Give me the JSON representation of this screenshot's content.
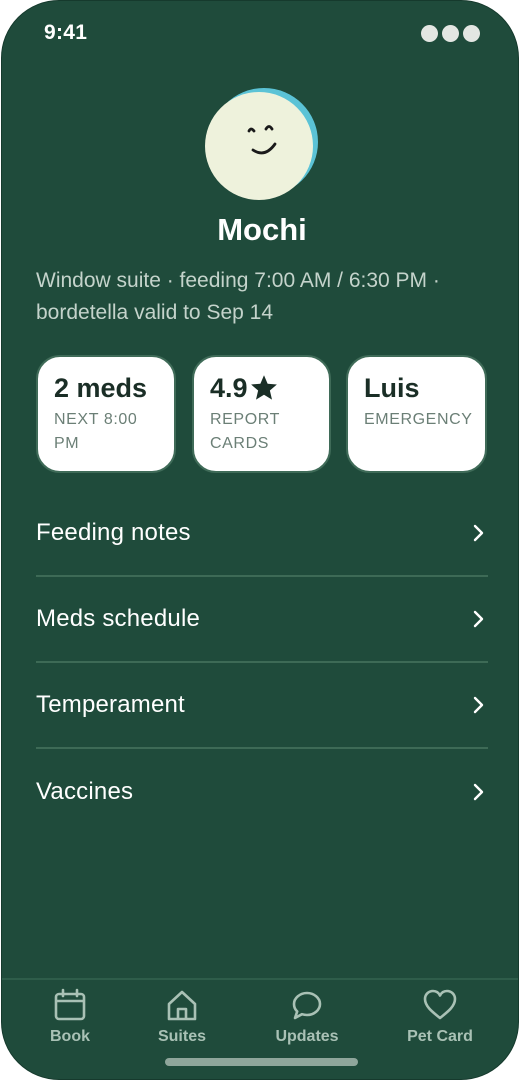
{
  "status_bar": {
    "time": "9:41"
  },
  "profile": {
    "name": "Mochi",
    "summary": "Window suite · feeding 7:00 AM / 6:30 PM · bordetella valid to Sep 14"
  },
  "stats": [
    {
      "value": "2 meds",
      "label": "NEXT 8:00 PM"
    },
    {
      "value": "4.9",
      "icon": "star-icon",
      "label": "REPORT CARDS"
    },
    {
      "value": "Luis",
      "label": "EMERGENCY"
    }
  ],
  "menu": [
    {
      "label": "Feeding notes",
      "icon": "chevron-right-icon"
    },
    {
      "label": "Meds schedule",
      "icon": "chevron-right-icon"
    },
    {
      "label": "Temperament",
      "icon": "chevron-right-icon"
    },
    {
      "label": "Vaccines",
      "icon": "chevron-right-icon"
    }
  ],
  "tabbar": [
    {
      "label": "Book",
      "icon": "calendar-icon"
    },
    {
      "label": "Suites",
      "icon": "home-icon"
    },
    {
      "label": "Updates",
      "icon": "chat-bubble-icon"
    },
    {
      "label": "Pet Card",
      "icon": "heart-icon"
    }
  ],
  "colors": {
    "background": "#1f4b3b",
    "card": "#ffffff",
    "avatar_face": "#eef2dc",
    "avatar_ring": "#5bc3d6"
  }
}
